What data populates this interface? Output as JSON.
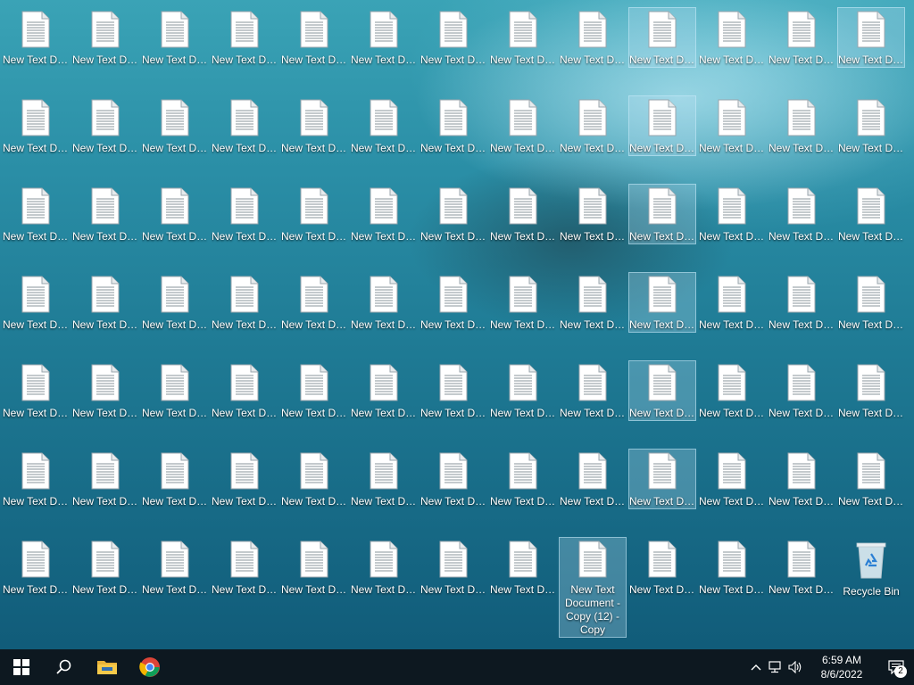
{
  "desktop": {
    "file_label_short": "New Text Documen...",
    "file_label_full": "New Text Document",
    "expanded_label": "New Text Document - Copy (12) - Copy",
    "recycle_label": "Recycle Bin"
  },
  "taskbar": {
    "time": "6:59 AM",
    "date": "8/6/2022",
    "notification_count": "2",
    "apps": [
      "start-icon",
      "search-icon",
      "file-explorer-icon",
      "chrome-icon"
    ],
    "tray_icons": [
      "chevron-up-icon",
      "network-icon",
      "volume-icon",
      "notification-icon"
    ]
  },
  "colors": {
    "taskbar": "#0d1820",
    "selection": "#bee1f5"
  }
}
